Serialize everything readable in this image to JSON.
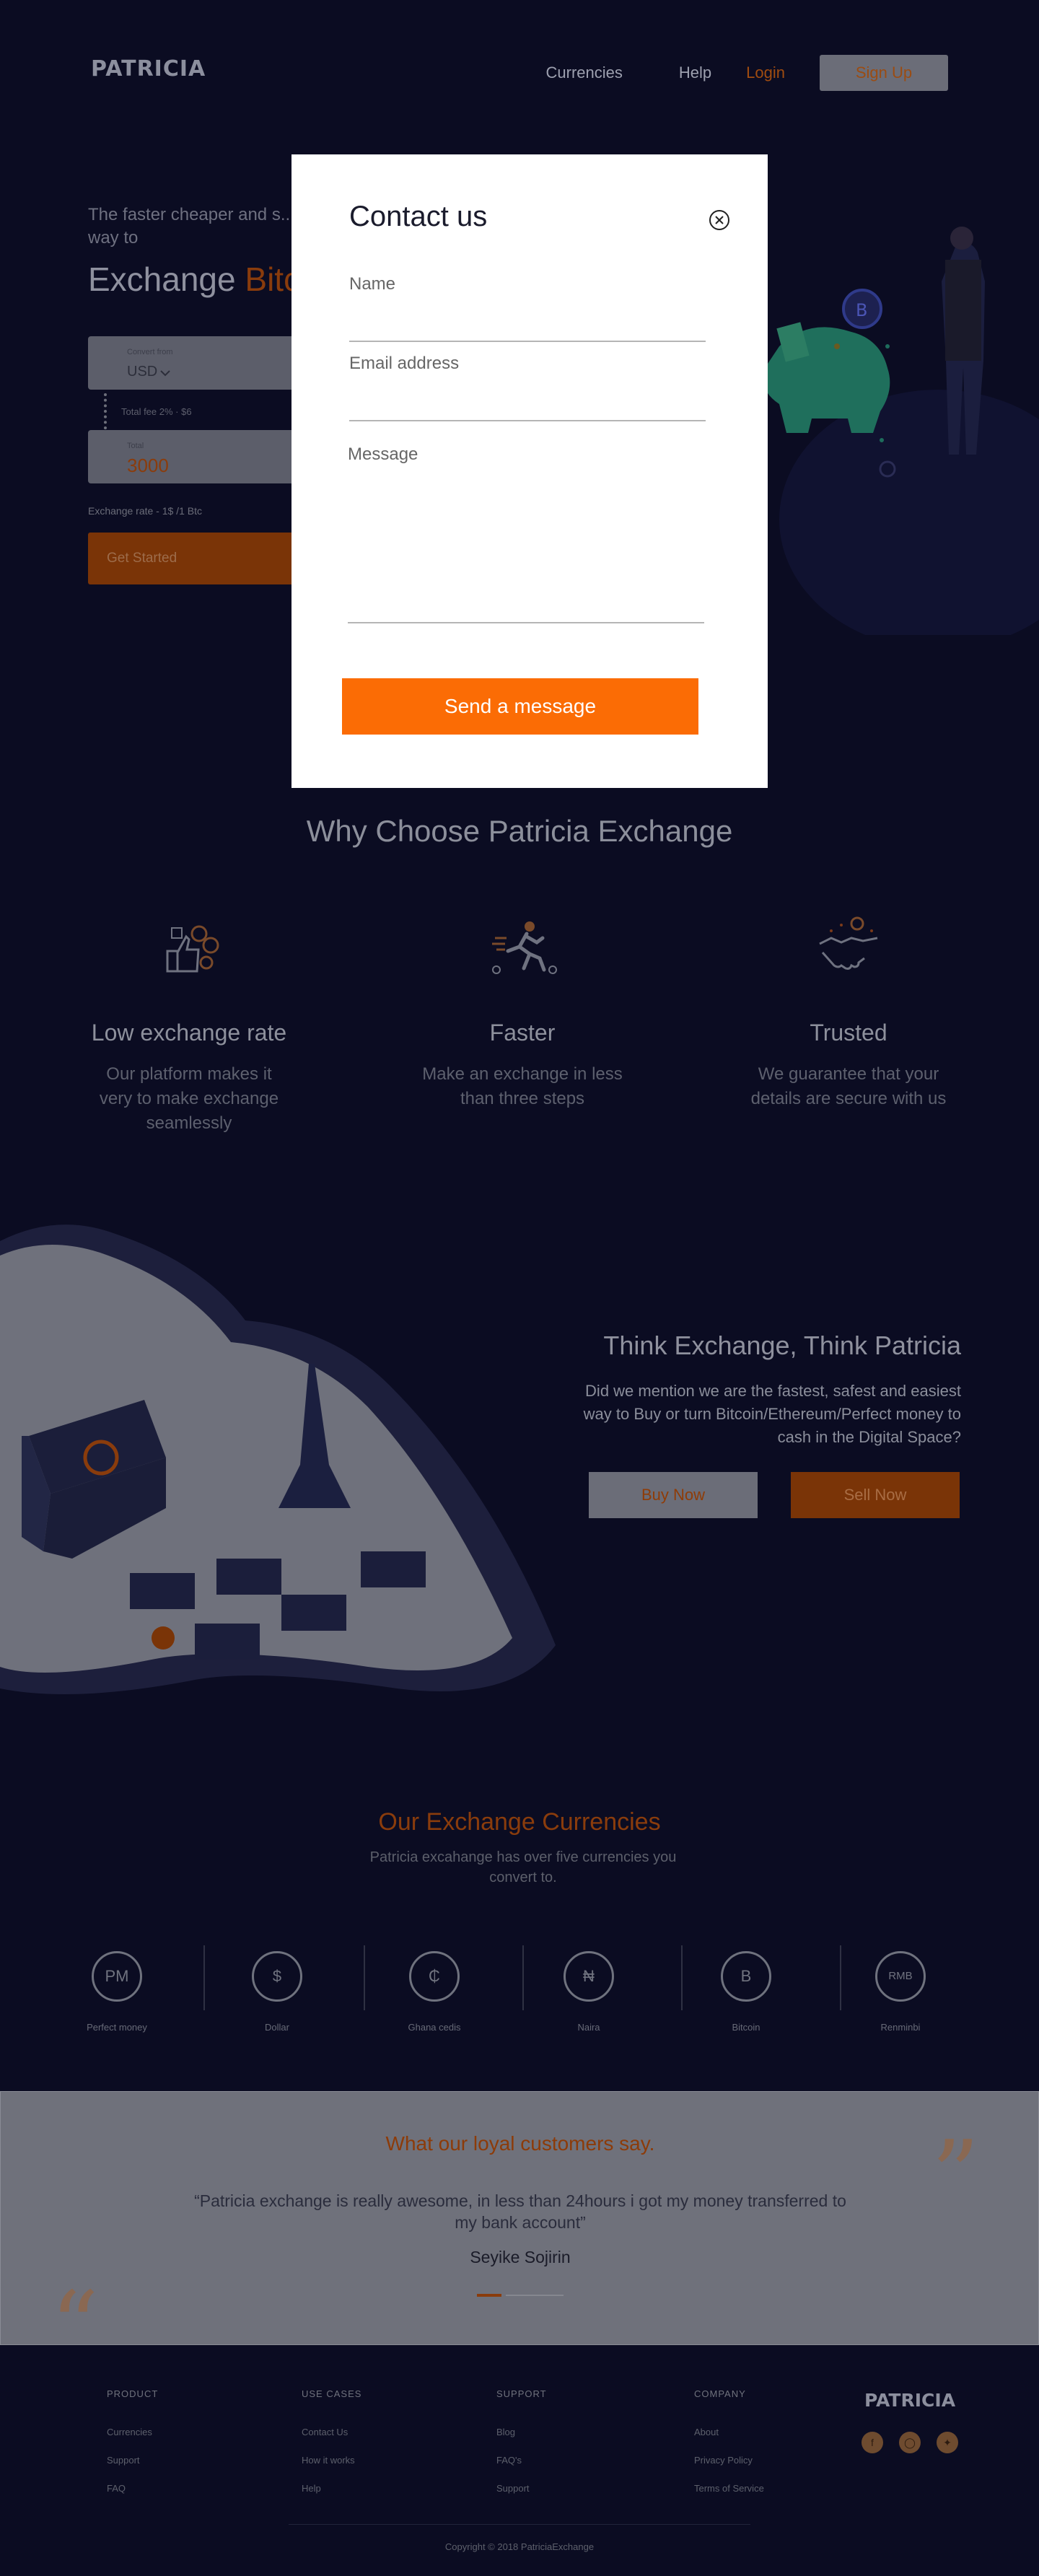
{
  "brand": {
    "logo": "PATRICIA"
  },
  "nav": {
    "currencies": "Currencies",
    "help": "Help",
    "login": "Login",
    "signup": "Sign Up"
  },
  "hero": {
    "subtitle": "The faster cheaper and s... way to",
    "title_prefix": "Exchange ",
    "title_accent": "Bitc",
    "convert_from_label": "Convert from",
    "convert_from_value": "USD",
    "fee_text": "Total fee 2%  ·  $6",
    "amount_label": "Total",
    "amount_value": "3000",
    "rate_text": "Exchange rate - 1$ /1 Btc",
    "cta": "Get Started"
  },
  "modal": {
    "title": "Contact us",
    "name_label": "Name",
    "email_label": "Email address",
    "message_label": "Message",
    "send_label": "Send a message"
  },
  "why": {
    "title": "Why Choose Patricia Exchange",
    "features": [
      {
        "title": "Low exchange rate",
        "text": "Our platform makes it very to make exchange seamlessly",
        "icon": "thumbs-up-coins-icon"
      },
      {
        "title": "Faster",
        "text": "Make an exchange in less than three steps",
        "icon": "running-man-icon"
      },
      {
        "title": "Trusted",
        "text": "We guarantee that your details are secure with us",
        "icon": "handshake-icon"
      }
    ]
  },
  "think": {
    "title": "Think Exchange, Think Patricia",
    "text": "Did we mention we are the fastest, safest and easiest way to Buy or turn Bitcoin/Ethereum/Perfect money to cash in the Digital Space?",
    "buy": "Buy Now",
    "sell": "Sell Now"
  },
  "currencies": {
    "title": "Our Exchange Currencies",
    "subtitle": "Patricia excahange has over five currencies you convert to.",
    "items": [
      {
        "symbol": "PM",
        "name": "Perfect money"
      },
      {
        "symbol": "$",
        "name": "Dollar"
      },
      {
        "symbol": "₵",
        "name": "Ghana cedis"
      },
      {
        "symbol": "₦",
        "name": "Naira"
      },
      {
        "symbol": "B",
        "name": "Bitcoin"
      },
      {
        "symbol": "RMB",
        "name": "Renminbi"
      }
    ]
  },
  "testimonial": {
    "title": "What our loyal customers say.",
    "quote": "“Patricia exchange is really awesome, in less than 24hours i got my money transferred to my bank account”",
    "author": "Seyike Sojirin"
  },
  "footer": {
    "product": {
      "heading": "PRODUCT",
      "links": [
        "Currencies",
        "Support",
        "FAQ"
      ]
    },
    "use_cases": {
      "heading": "USE CASES",
      "links": [
        "Contact Us",
        "How it works",
        "Help"
      ]
    },
    "support": {
      "heading": "SUPPORT",
      "links": [
        "Blog",
        "FAQ's",
        "Support"
      ]
    },
    "company": {
      "heading": "COMPANY",
      "links": [
        "About",
        "Privacy Policy",
        "Terms of Service"
      ]
    },
    "logo": "PATRICIA",
    "copyright": "Copyright © 2018 PatriciaExchange"
  },
  "colors": {
    "accent": "#fb6c05",
    "background": "#0b0c22",
    "modal": "#ffffff"
  }
}
